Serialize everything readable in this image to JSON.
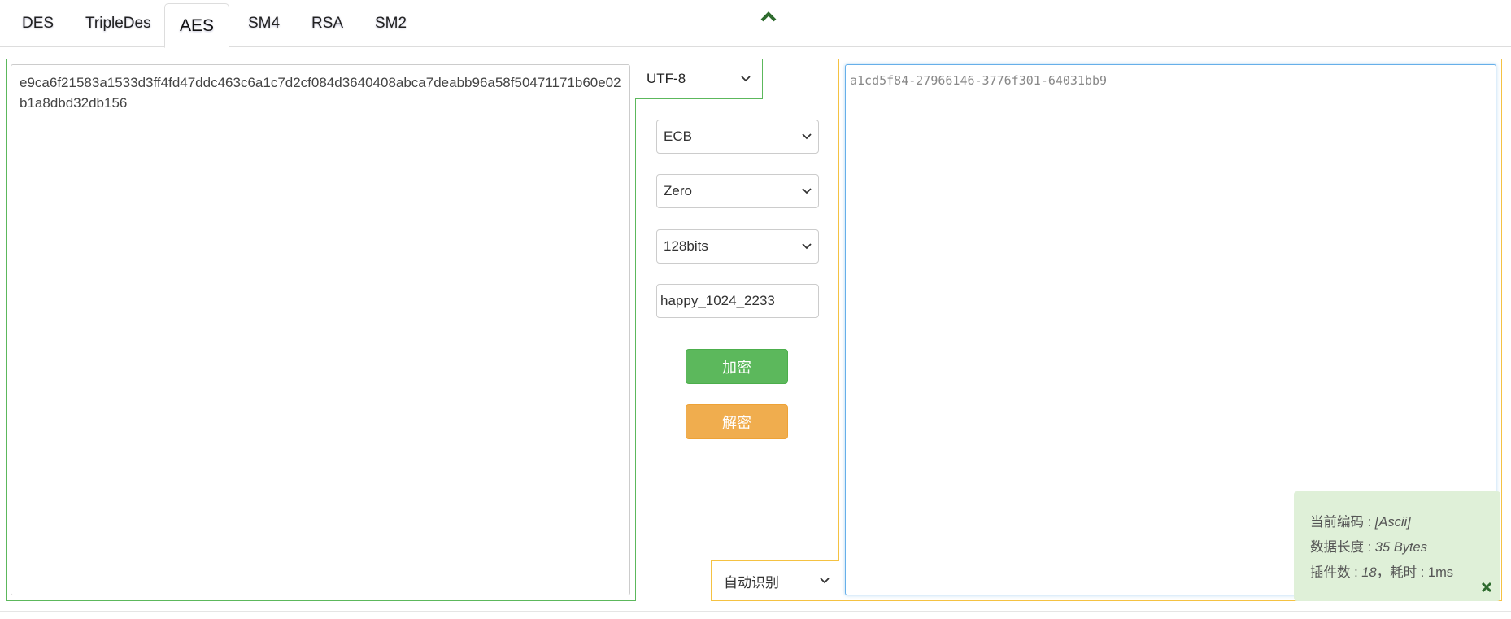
{
  "tabs": [
    {
      "label": "DES",
      "active": false
    },
    {
      "label": "TripleDes",
      "active": false
    },
    {
      "label": "AES",
      "active": true
    },
    {
      "label": "SM4",
      "active": false
    },
    {
      "label": "RSA",
      "active": false
    },
    {
      "label": "SM2",
      "active": false
    }
  ],
  "collapse_icon": "chevron-up-icon",
  "left_input": {
    "value": "e9ca6f21583a1533d3ff4fd47ddc463c6a1c7d2cf084d3640408abca7deabb96a58f50471171b60e02b1a8dbd32db156"
  },
  "encoding_select": {
    "value": "UTF-8"
  },
  "controls": {
    "mode": "ECB",
    "padding": "Zero",
    "key_size": "128bits",
    "key": "happy_1024_2233"
  },
  "buttons": {
    "encrypt": "加密",
    "decrypt": "解密"
  },
  "output": {
    "value": "a1cd5f84-27966146-3776f301-64031bb9"
  },
  "output_encoding_select": {
    "value": "自动识别"
  },
  "info_panel": {
    "encoding_label": "当前编码 : ",
    "encoding_value": "[Ascii]",
    "length_label": "数据长度 : ",
    "length_value": "35 Bytes",
    "plugins_label": "插件数 : ",
    "plugins_value": "18",
    "time_label": "，耗时 : ",
    "time_value": "1ms",
    "close_icon": "close-icon"
  },
  "colors": {
    "green": "#5cb85c",
    "orange": "#f0ad4e",
    "yellow_border": "#f5c242",
    "info_bg": "#dff0d8"
  }
}
